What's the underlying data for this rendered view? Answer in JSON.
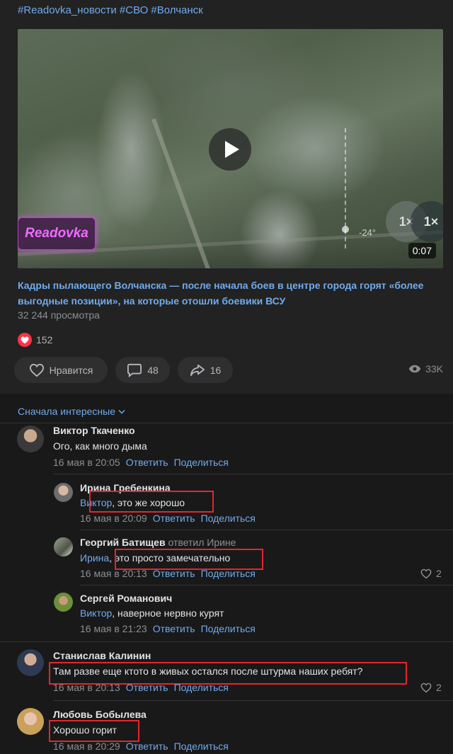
{
  "post": {
    "hashtags": "#Readovka_новости #СВО #Волчанск",
    "video": {
      "logo_text": "Readovka",
      "duration": "0:07",
      "overlay_angle": "-24°",
      "overlay_zoom_a": "1×",
      "overlay_zoom_b": "1×"
    },
    "title": "Кадры пылающего Волчанска — после начала боев в центре города горят «более выгодные позиции», на которые отошли боевики ВСУ",
    "views": "32 244 просмотра",
    "reactions": {
      "count": "152",
      "icon": "heart-icon",
      "color": "#ff3347"
    },
    "actions": {
      "like_label": "Нравится",
      "comments_count": "48",
      "shares_count": "16",
      "views_count": "33K"
    }
  },
  "comments_section": {
    "sort_label": "Сначала интересные",
    "comments": [
      {
        "author": "Виктор Ткаченко",
        "text": "Ого, как много дыма",
        "time": "16 мая в 20:05",
        "reply": "Ответить",
        "share": "Поделиться"
      },
      {
        "author": "Ирина Гребенкина",
        "mention": "Виктор",
        "text": ", это же хорошо",
        "time": "16 мая в 20:09",
        "reply": "Ответить",
        "share": "Поделиться"
      },
      {
        "author": "Георгий Батищев",
        "replied_to": "ответил Ирине",
        "mention": "Ирина",
        "text": ", это просто замечательно",
        "time": "16 мая в 20:13",
        "reply": "Ответить",
        "share": "Поделиться",
        "likes": "2"
      },
      {
        "author": "Сергей Романович",
        "mention": "Виктор",
        "text": ", наверное нервно курят",
        "time": "16 мая в 21:23",
        "reply": "Ответить",
        "share": "Поделиться"
      },
      {
        "author": "Станислав Калинин",
        "text": "Там разве еще ктото в живых остался после штурма наших ребят?",
        "time": "16 мая в 20:13",
        "reply": "Ответить",
        "share": "Поделиться",
        "likes": "2"
      },
      {
        "author": "Любовь Бобылева",
        "text": "Хорошо горит",
        "time": "16 мая в 20:29",
        "reply": "Ответить",
        "share": "Поделиться"
      }
    ]
  },
  "colors": {
    "accent": "#71aaeb",
    "highlight_box": "#e4262d",
    "background": "#191919"
  }
}
